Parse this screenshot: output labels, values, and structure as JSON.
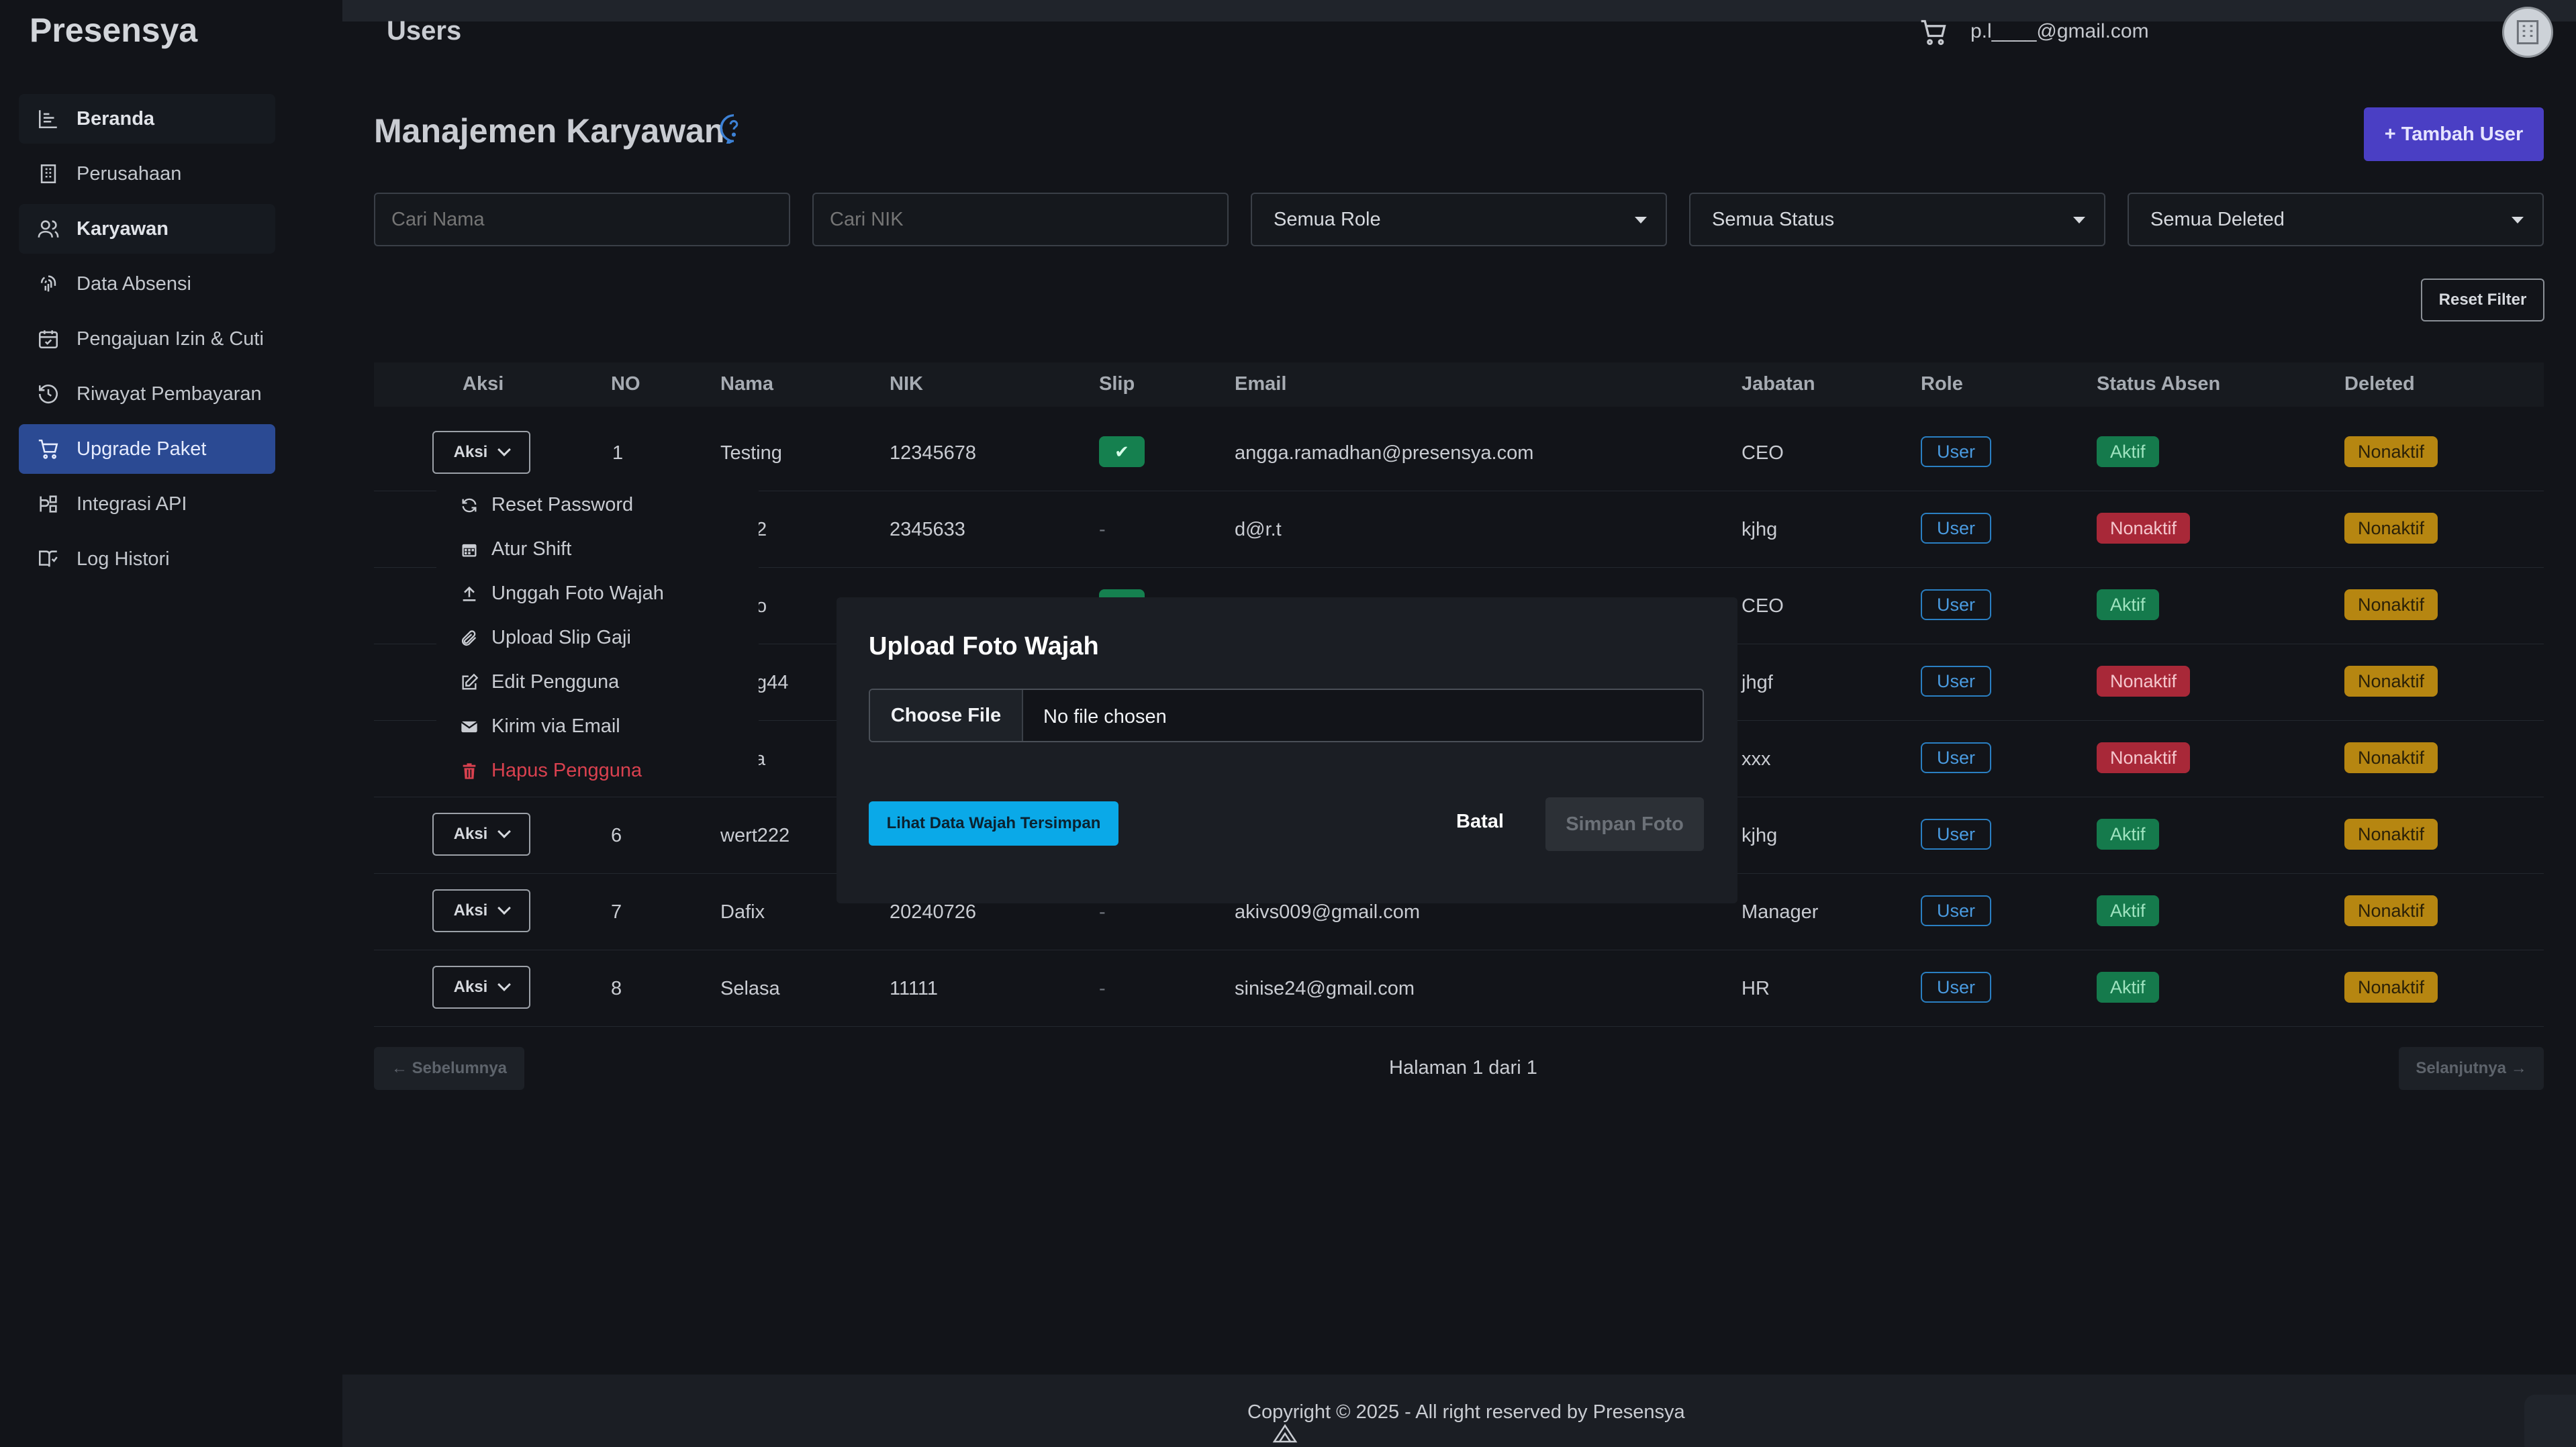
{
  "app": {
    "brand": "Presensya",
    "page_header": "Users",
    "user_email": "p.l____@gmail.com"
  },
  "sidebar": {
    "items": [
      {
        "label": "Beranda",
        "icon": "chart-icon"
      },
      {
        "label": "Perusahaan",
        "icon": "building-icon"
      },
      {
        "label": "Karyawan",
        "icon": "users-icon"
      },
      {
        "label": "Data Absensi",
        "icon": "fingerprint-icon"
      },
      {
        "label": "Pengajuan Izin & Cuti",
        "icon": "calendar-check-icon"
      },
      {
        "label": "Riwayat Pembayaran",
        "icon": "history-icon"
      },
      {
        "label": "Upgrade Paket",
        "icon": "cart-icon"
      },
      {
        "label": "Integrasi API",
        "icon": "api-icon"
      },
      {
        "label": "Log Histori",
        "icon": "book-icon"
      }
    ]
  },
  "main": {
    "title": "Manajemen Karyawan",
    "add_button": "+ Tambah User",
    "filters": {
      "search_name_placeholder": "Cari Nama",
      "search_nik_placeholder": "Cari NIK",
      "role": "Semua Role",
      "status": "Semua Status",
      "deleted": "Semua Deleted"
    },
    "reset_filter": "Reset Filter",
    "table": {
      "headers": [
        "Aksi",
        "NO",
        "Nama",
        "NIK",
        "Slip",
        "Email",
        "Jabatan",
        "Role",
        "Status Absen",
        "Deleted"
      ],
      "aksi_label": "Aksi",
      "rows": [
        {
          "no": "1",
          "nama": "Testing",
          "nik": "12345678",
          "slip": "✔",
          "email": "angga.ramadhan@presensya.com",
          "jabatan": "CEO",
          "role": "User",
          "status": "Aktif",
          "deleted": "Nonaktif"
        },
        {
          "no": "",
          "nama": "2",
          "nik": "2345633",
          "slip": "-",
          "email": "d@r.t",
          "jabatan": "kjhg",
          "role": "User",
          "status": "Nonaktif",
          "deleted": "Nonaktif"
        },
        {
          "no": "",
          "nama": "o",
          "nik": "",
          "slip": "",
          "email": "",
          "jabatan": "CEO",
          "role": "User",
          "status": "Aktif",
          "deleted": "Nonaktif"
        },
        {
          "no": "",
          "nama": "g44",
          "nik": "",
          "slip": "",
          "email": "",
          "jabatan": "jhgf",
          "role": "User",
          "status": "Nonaktif",
          "deleted": "Nonaktif"
        },
        {
          "no": "",
          "nama": "a",
          "nik": "",
          "slip": "",
          "email": "",
          "jabatan": "xxx",
          "role": "User",
          "status": "Nonaktif",
          "deleted": "Nonaktif"
        },
        {
          "no": "6",
          "nama": "wert222",
          "nik": "",
          "slip": "",
          "email": "",
          "jabatan": "kjhg",
          "role": "User",
          "status": "Aktif",
          "deleted": "Nonaktif"
        },
        {
          "no": "7",
          "nama": "Dafix",
          "nik": "20240726",
          "slip": "-",
          "email": "akivs009@gmail.com",
          "jabatan": "Manager",
          "role": "User",
          "status": "Aktif",
          "deleted": "Nonaktif"
        },
        {
          "no": "8",
          "nama": "Selasa",
          "nik": "11111",
          "slip": "-",
          "email": "sinise24@gmail.com",
          "jabatan": "HR",
          "role": "User",
          "status": "Aktif",
          "deleted": "Nonaktif"
        }
      ]
    },
    "action_menu": [
      {
        "label": "Reset Password",
        "icon": "refresh-icon"
      },
      {
        "label": "Atur Shift",
        "icon": "calendar-icon"
      },
      {
        "label": "Unggah Foto Wajah",
        "icon": "upload-icon"
      },
      {
        "label": "Upload Slip Gaji",
        "icon": "paperclip-icon"
      },
      {
        "label": "Edit Pengguna",
        "icon": "edit-icon"
      },
      {
        "label": "Kirim via Email",
        "icon": "mail-icon"
      },
      {
        "label": "Hapus Pengguna",
        "icon": "trash-icon"
      }
    ],
    "pagination": {
      "prev": "← Sebelumnya",
      "next": "Selanjutnya →",
      "info": "Halaman 1 dari 1"
    }
  },
  "modal": {
    "title": "Upload Foto Wajah",
    "choose_file": "Choose File",
    "no_file": "No file chosen",
    "view_saved": "Lihat Data Wajah Tersimpan",
    "cancel": "Batal",
    "save": "Simpan Foto"
  },
  "footer": {
    "copyright": "Copyright © 2025 - All right reserved by Presensya"
  },
  "colors": {
    "accent": "#4a3fc4",
    "active_nav": "#2b4a93",
    "aktif": "#157a4c",
    "nonaktif": "#a82838",
    "deleted": "#b68611",
    "info": "#0aa9e8"
  }
}
